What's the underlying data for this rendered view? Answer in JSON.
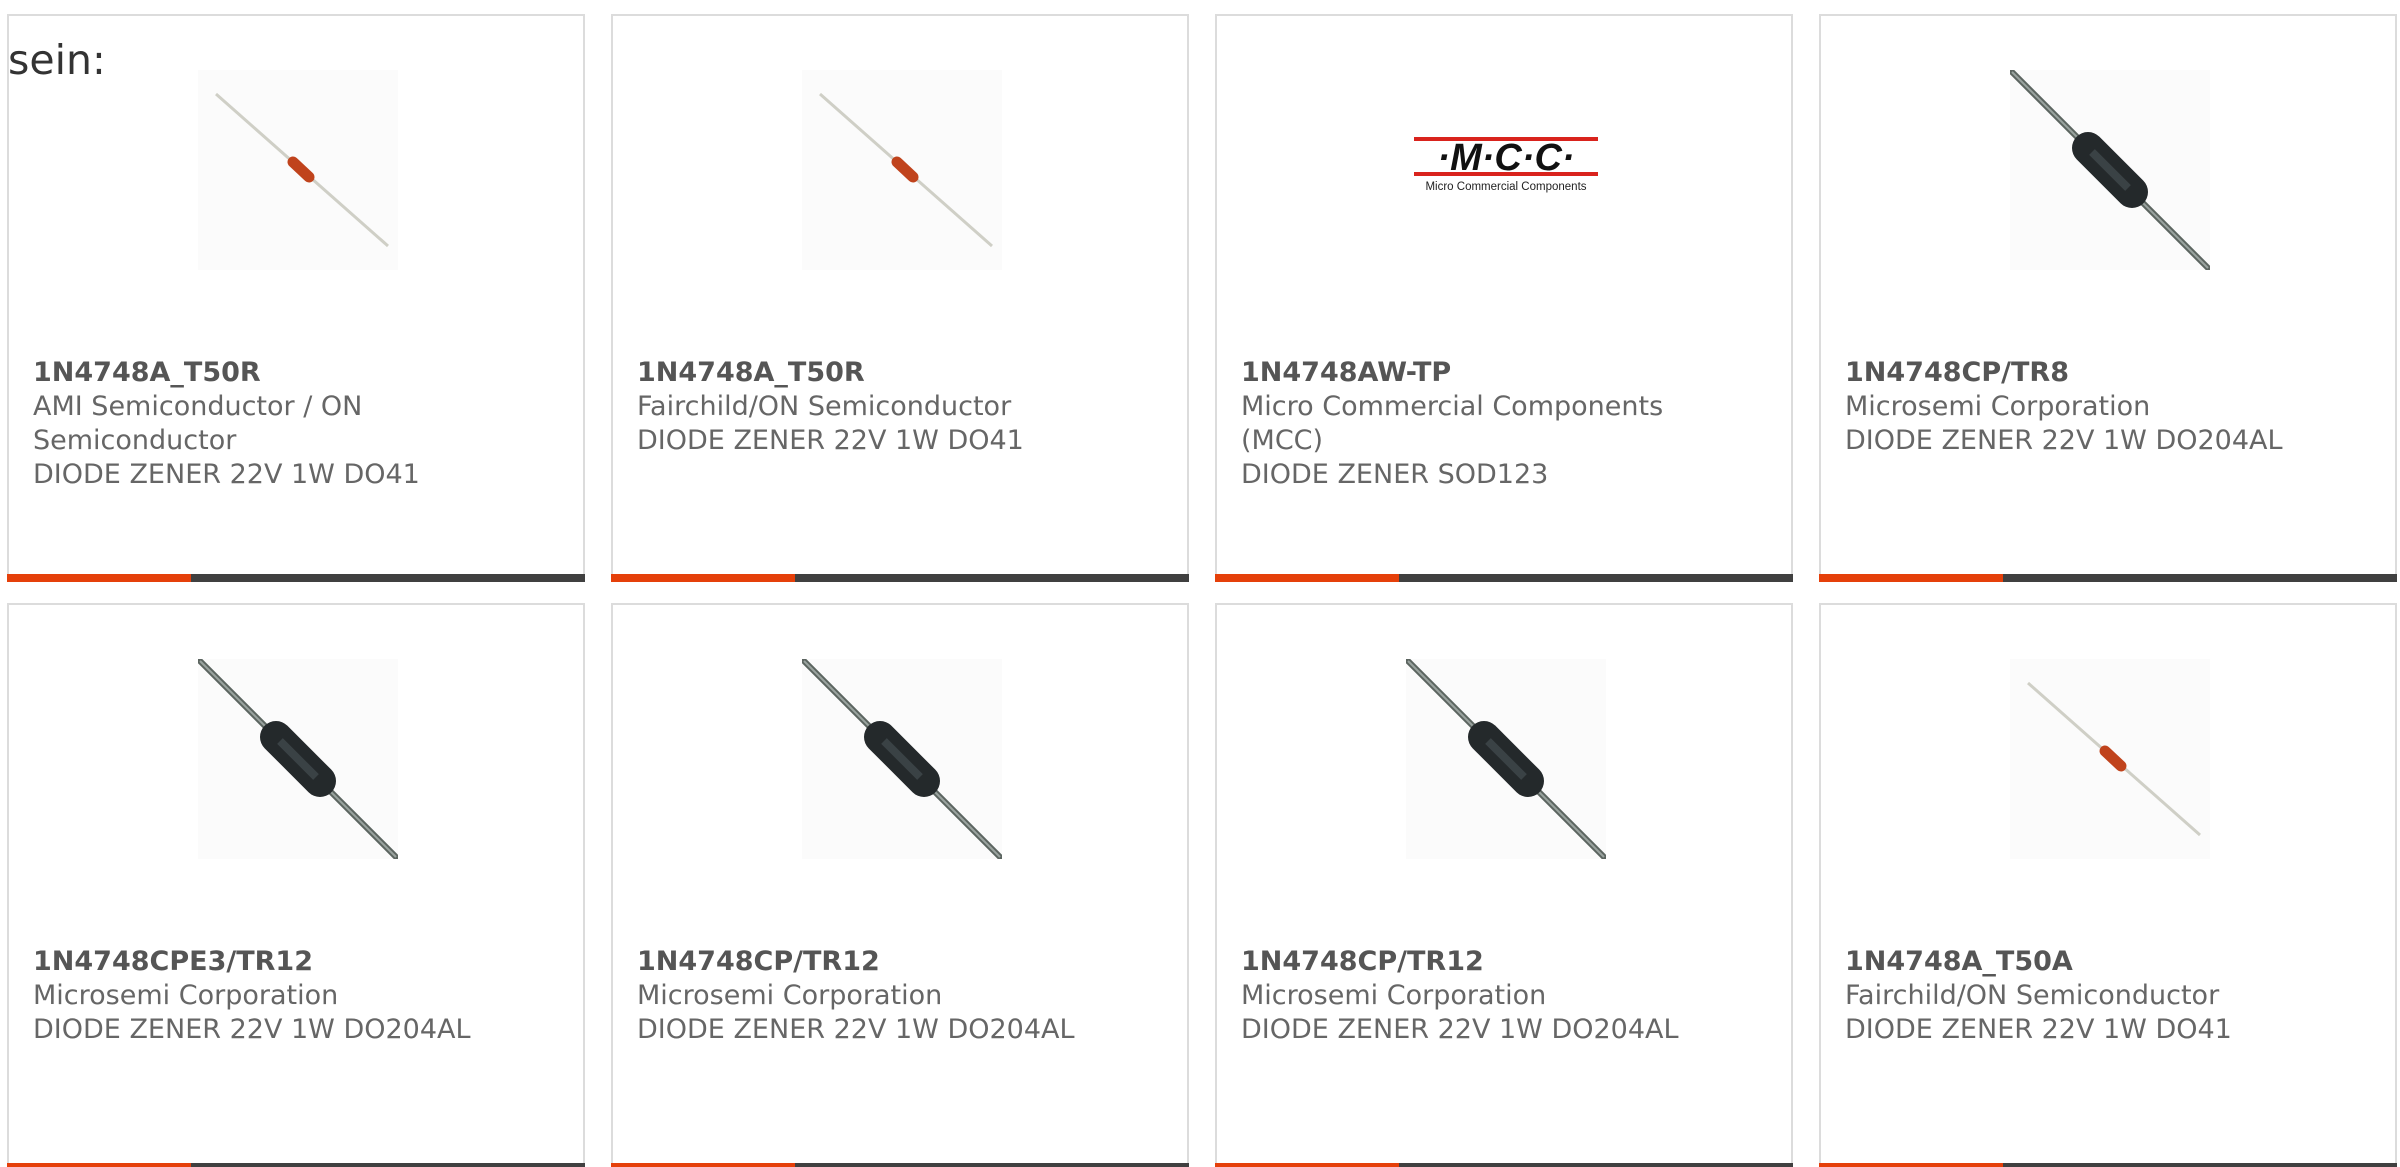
{
  "intro": "sein:",
  "colors": {
    "accent": "#e5400a",
    "bar_dark": "#404040",
    "text": "#666666",
    "border": "#dcdcdc"
  },
  "products": [
    {
      "part_number": "1N4748A_T50R",
      "manufacturer": "AMI Semiconductor / ON Semiconductor",
      "description": "DIODE ZENER 22V 1W DO41",
      "image": "small-axial-diode-icon"
    },
    {
      "part_number": "1N4748A_T50R",
      "manufacturer": "Fairchild/ON Semiconductor",
      "description": "DIODE ZENER 22V 1W DO41",
      "image": "small-axial-diode-icon"
    },
    {
      "part_number": "1N4748AW-TP",
      "manufacturer": "Micro Commercial Components (MCC)",
      "description": "DIODE ZENER SOD123",
      "image": "mcc-logo",
      "logo_text": "·M·C·C·",
      "logo_subtext": "Micro Commercial Components"
    },
    {
      "part_number": "1N4748CP/TR8",
      "manufacturer": "Microsemi Corporation",
      "description": "DIODE ZENER 22V 1W DO204AL",
      "image": "black-axial-diode-icon"
    },
    {
      "part_number": "1N4748CPE3/TR12",
      "manufacturer": "Microsemi Corporation",
      "description": "DIODE ZENER 22V 1W DO204AL",
      "image": "black-axial-diode-icon"
    },
    {
      "part_number": "1N4748CP/TR12",
      "manufacturer": "Microsemi Corporation",
      "description": "DIODE ZENER 22V 1W DO204AL",
      "image": "black-axial-diode-icon"
    },
    {
      "part_number": "1N4748CP/TR12",
      "manufacturer": "Microsemi Corporation",
      "description": "DIODE ZENER 22V 1W DO204AL",
      "image": "black-axial-diode-icon"
    },
    {
      "part_number": "1N4748A_T50A",
      "manufacturer": "Fairchild/ON Semiconductor",
      "description": "DIODE ZENER 22V 1W DO41",
      "image": "small-axial-diode-icon"
    }
  ]
}
